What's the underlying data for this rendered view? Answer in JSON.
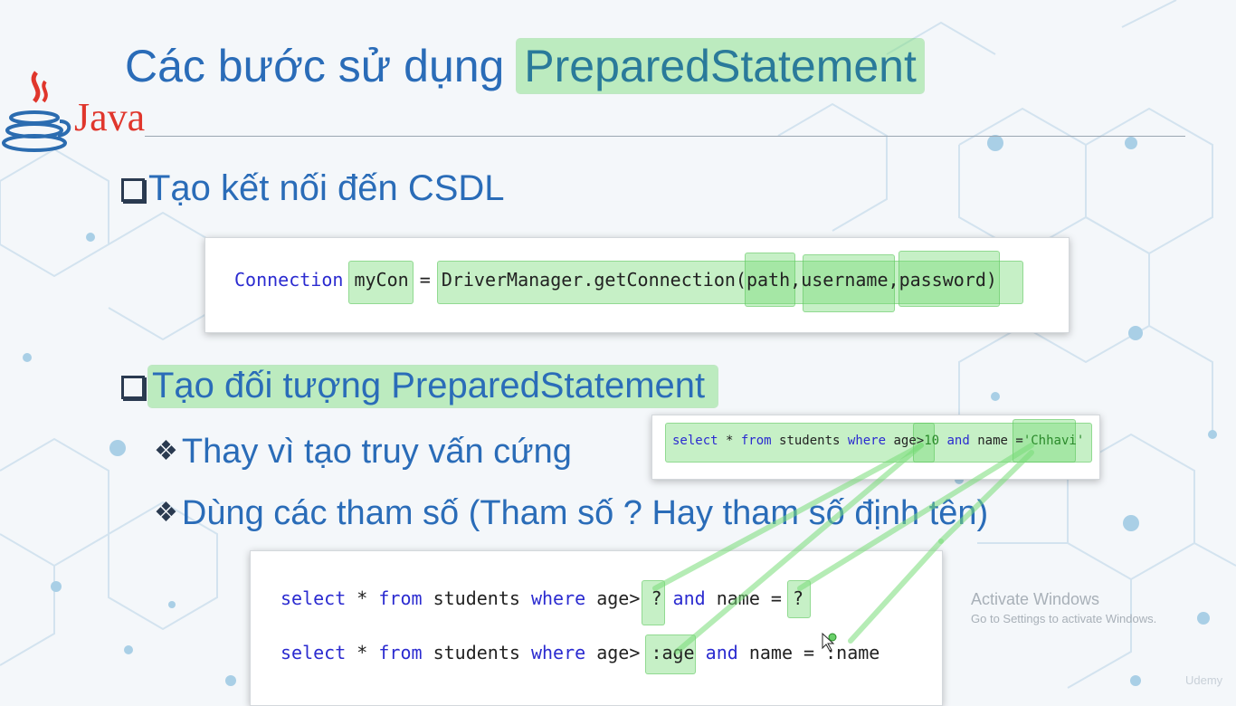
{
  "slide": {
    "title_prefix": "Các bước sử dụng",
    "title_highlight": "PreparedStatement",
    "logo_text": "Java",
    "bullet1": "Tạo kết nối đến CSDL",
    "code1": {
      "type": "Connection",
      "var": "myCon",
      "eq": " = ",
      "cls": "DriverManager.",
      "method": "getConnection(",
      "arg1": "path",
      "comma1": ",",
      "arg2": "username",
      "comma2": ",",
      "arg3": "password",
      "close": ")"
    },
    "bullet2": "Tạo đối tượng PreparedStatement",
    "sub1": "Thay vì tạo truy vấn cứng",
    "sub2": "Dùng các tham số (Tham số ? Hay tham số định tên)",
    "hard_query": {
      "select": "select",
      "star": " * ",
      "from": "from",
      "table": " students ",
      "where": "where",
      "cond1": " age>",
      "val1": "10",
      "sp": " ",
      "and": "and",
      "cond2": " name =",
      "val2": "'Chhavi'"
    },
    "param_query1": {
      "select": "select",
      "star": " * ",
      "from": "from",
      "table": " students ",
      "where": "where",
      "cond1": " age> ",
      "p1": "?",
      "sp": " ",
      "and": "and",
      "cond2": " name = ",
      "p2": "?"
    },
    "param_query2": {
      "select": "select",
      "star": " * ",
      "from": "from",
      "table": " students ",
      "where": "where",
      "cond1": " age> ",
      "p1": ":age",
      "sp": " ",
      "and": "and",
      "cond2": " name = ",
      "p2": ":name"
    },
    "watermark_line1": "Activate Windows",
    "watermark_line2": "Go to Settings to activate Windows.",
    "brand": "Udemy"
  },
  "colors": {
    "title": "#2a6cb8",
    "highlight": "#78dc78",
    "keyword": "#2b2bd0",
    "string": "#2a8a2a"
  }
}
